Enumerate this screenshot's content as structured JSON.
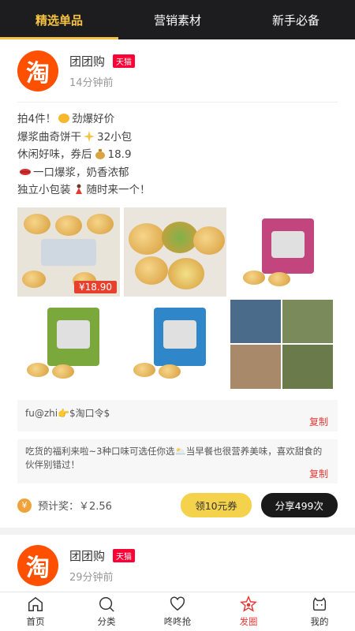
{
  "tabs": [
    {
      "label": "精选单品"
    },
    {
      "label": "营销素材"
    },
    {
      "label": "新手必备"
    }
  ],
  "post1": {
    "logo_char": "淘",
    "name": "团团购",
    "badge": "天猫",
    "time": "14分钟前",
    "desc": [
      {
        "pre": "拍4件！",
        "emoji": "fist",
        "post": "劲爆好价"
      },
      {
        "pre": "爆浆曲奇饼干",
        "emoji": "sparkle",
        "post": "32小包"
      },
      {
        "pre": "休闲好味，券后",
        "emoji": "moneybag",
        "post": "18.9"
      },
      {
        "pre": "",
        "emoji": "lips",
        "post": "一口爆浆，奶香浓郁"
      },
      {
        "pre": "独立小包装",
        "emoji": "dancer",
        "post": "随时来一个！"
      }
    ],
    "price_tag": "¥18.90",
    "copy1": "fu@zhi👉$淘口令$",
    "copy_label": "复制",
    "copy2": "吃货的福利来啦~3种口味可选任你选🌥️当早餐也很营养美味，喜欢甜食的伙伴别错过！",
    "reward": "预计奖：￥2.56",
    "coin": "¥",
    "coupon_btn": "领10元券",
    "share_btn": "分享499次"
  },
  "post2": {
    "logo_char": "淘",
    "name": "团团购",
    "badge": "天猫",
    "time": "29分钟前"
  },
  "nav": [
    {
      "label": "首页",
      "icon": "home-icon"
    },
    {
      "label": "分类",
      "icon": "search-icon"
    },
    {
      "label": "咚咚抢",
      "icon": "heart-icon"
    },
    {
      "label": "发圈",
      "icon": "star-icon"
    },
    {
      "label": "我的",
      "icon": "face-icon"
    }
  ],
  "colors": {
    "accent": "#f5c242",
    "active_nav": "#e53935",
    "topbar": "#1d1d1f"
  }
}
